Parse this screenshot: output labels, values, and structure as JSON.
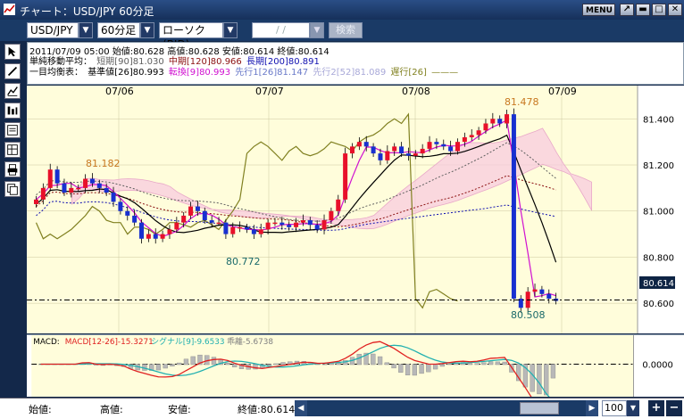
{
  "window": {
    "title": "チャート：USD/JPY 60分足",
    "menu_label": "MENU ▾"
  },
  "toolbar": {
    "pair": "USD/JPY",
    "timeframe": "60分足",
    "chart_type": "ローソク(BID)",
    "date_placeholder": "/ /",
    "search_label": "検索"
  },
  "info": {
    "ohlc": "2011/07/09 05:00  始値:80.628  高値:80.628  安値:80.614  終値:80.614",
    "sma_label": "単純移動平均：",
    "sma_short": "短期[90]81.030",
    "sma_mid": "中期[120]80.966",
    "sma_long": "長期[200]80.891",
    "ichimoku_label": "一目均衡表：",
    "kijun": "基準値[26]80.993",
    "tenkan": "転換[9]80.993",
    "senko1": "先行1[26]81.147",
    "senko2": "先行2[52]81.089",
    "chikou": "遅行[26]",
    "colors": {
      "sma_short": "#606060",
      "sma_mid": "#8b1010",
      "sma_long": "#1010b0",
      "tenkan": "#d010d0",
      "senko1": "#6878c8",
      "senko2": "#a8a8d8",
      "chikou": "#808020"
    }
  },
  "chart_data": {
    "type": "line",
    "x_dates": [
      "07/06",
      "07/07",
      "07/08",
      "07/09"
    ],
    "y_ticks": [
      "81.400",
      "81.200",
      "81.000",
      "80.800",
      "80.600"
    ],
    "ylim": [
      80.5,
      81.5
    ],
    "annotations": {
      "high_1": "81.182",
      "low_1": "80.772",
      "high_2": "81.478",
      "low_2": "80.508"
    },
    "current_price": "80.614",
    "reference_level": 80.614,
    "close_series": [
      81.05,
      81.1,
      81.18,
      81.12,
      81.08,
      81.1,
      81.1,
      81.14,
      81.12,
      81.1,
      81.08,
      81.04,
      81.0,
      80.98,
      80.95,
      80.88,
      80.9,
      80.88,
      80.9,
      80.92,
      80.95,
      80.98,
      81.02,
      81.0,
      80.96,
      80.95,
      80.95,
      80.9,
      80.93,
      80.93,
      80.92,
      80.9,
      80.92,
      80.95,
      80.95,
      80.94,
      80.93,
      80.95,
      80.96,
      80.94,
      80.92,
      80.96,
      81.0,
      81.05,
      81.25,
      81.28,
      81.3,
      81.28,
      81.25,
      81.22,
      81.26,
      81.28,
      81.25,
      81.24,
      81.25,
      81.27,
      81.3,
      81.29,
      81.28,
      81.26,
      81.3,
      81.32,
      81.33,
      81.35,
      81.38,
      81.4,
      81.38,
      81.42,
      80.62,
      80.58,
      80.65,
      80.66,
      80.64,
      80.62,
      80.61
    ]
  },
  "macd": {
    "label": "MACD:",
    "macd_value": "MACD[12-26]-15.3271",
    "signal_value": "シグナル[9]-9.6533",
    "divergence_value": "乖離-5.6738",
    "zero_tick": "0.0000",
    "colors": {
      "macd": "#e02020",
      "signal": "#20b0b0",
      "divergence": "#a0a0a0"
    }
  },
  "status": {
    "open": "始値:",
    "high": "高値:",
    "low": "安値:",
    "close": "終値:80.614",
    "zoom": "100"
  }
}
